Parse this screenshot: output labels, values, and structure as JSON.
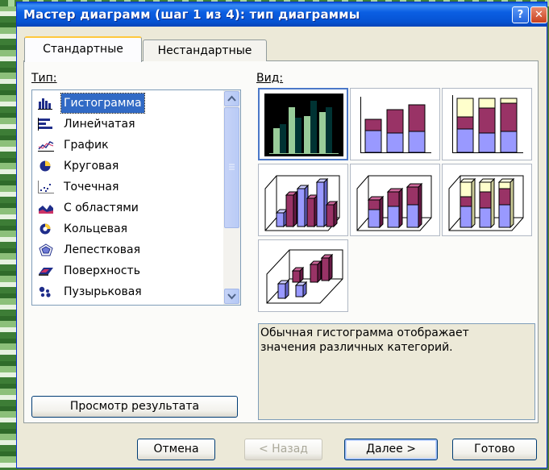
{
  "window": {
    "title": "Мастер диаграмм (шаг 1 из 4): тип диаграммы",
    "help_label": "?",
    "close_label": "✕"
  },
  "tabs": [
    {
      "label": "Стандартные",
      "active": true
    },
    {
      "label": "Нестандартные",
      "active": false
    }
  ],
  "type_label": "Тип:",
  "view_label": "Вид:",
  "chart_types": [
    {
      "label": "Гистограмма",
      "icon": "column-chart-icon",
      "selected": true
    },
    {
      "label": "Линейчатая",
      "icon": "bar-chart-icon"
    },
    {
      "label": "График",
      "icon": "line-chart-icon"
    },
    {
      "label": "Круговая",
      "icon": "pie-chart-icon"
    },
    {
      "label": "Точечная",
      "icon": "scatter-chart-icon"
    },
    {
      "label": "С областями",
      "icon": "area-chart-icon"
    },
    {
      "label": "Кольцевая",
      "icon": "doughnut-chart-icon"
    },
    {
      "label": "Лепестковая",
      "icon": "radar-chart-icon"
    },
    {
      "label": "Поверхность",
      "icon": "surface-chart-icon"
    },
    {
      "label": "Пузырьковая",
      "icon": "bubble-chart-icon"
    }
  ],
  "subtypes": [
    {
      "name": "clustered-column",
      "selected": true
    },
    {
      "name": "stacked-column"
    },
    {
      "name": "100-stacked-column"
    },
    {
      "name": "3d-clustered-column"
    },
    {
      "name": "3d-stacked-column"
    },
    {
      "name": "3d-100-stacked-column"
    },
    {
      "name": "3d-column"
    }
  ],
  "description": "Обычная гистограмма отображает\nзначения различных категорий.",
  "preview_button": "Просмотр результата",
  "buttons": {
    "cancel": "Отмена",
    "back": "< Назад",
    "next": "Далее >",
    "finish": "Готово"
  },
  "colors": {
    "bar_periwinkle": "#9999ff",
    "bar_plum": "#993366",
    "bar_cream": "#ffffcc",
    "bar_green": "#99cc99",
    "selection": "#316ac5"
  }
}
